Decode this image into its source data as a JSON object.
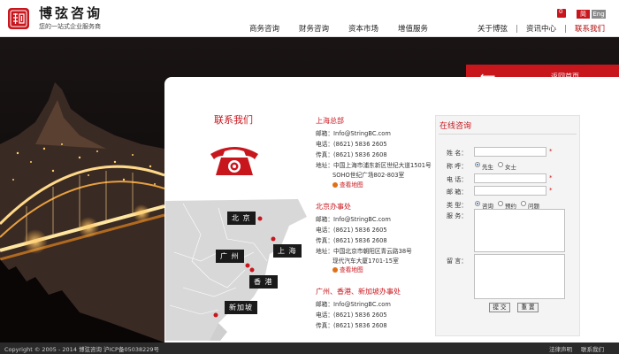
{
  "header": {
    "brand_name": "博弦咨询",
    "brand_tagline": "您的一站式企业服务商",
    "nav": [
      "商务咨询",
      "财务咨询",
      "资本市场",
      "增值服务"
    ],
    "nav_right": [
      "关于博弦",
      "资讯中心",
      "联系我们"
    ],
    "cart_count": "0",
    "lang_cn": "简",
    "lang_en": "Eng"
  },
  "back_home": {
    "label": "返回首页",
    "arrow": "⟵"
  },
  "contact": {
    "title": "联系我们",
    "cities": [
      "北 京",
      "上 海",
      "广 州",
      "香 港",
      "新加坡"
    ]
  },
  "offices": [
    {
      "title": "上海总部",
      "email": "邮箱：Info@StringBC.com",
      "phone": "电话：(8621) 5836 2605",
      "fax": "传真：(8621) 5836 2608",
      "address": "地址：中国上海市浦东新区世纪大道1501号",
      "address2": "SOHO世纪广场802-803室",
      "map_link": "查看地图"
    },
    {
      "title": "北京办事处",
      "email": "邮箱：Info@StringBC.com",
      "phone": "电话：(8621) 5836 2605",
      "fax": "传真：(8621) 5836 2608",
      "address": "地址：中国北京市朝阳区青云路38号",
      "address2": "现代汽车大厦1701-15室",
      "map_link": "查看地图"
    },
    {
      "title": "广州、香港、新加坡办事处",
      "email": "邮箱：Info@StringBC.com",
      "phone": "电话：(8621) 5836 2605",
      "fax": "传真：(8621) 5836 2608"
    }
  ],
  "form": {
    "title": "在线咨询",
    "name_label": "姓 名：",
    "salutation_label": "称 呼：",
    "salutation_options": [
      "先生",
      "女士"
    ],
    "phone_label": "电 话：",
    "email_label": "邮 箱：",
    "type_label": "类 型：",
    "type_options": [
      "咨询",
      "预约",
      "问题"
    ],
    "service_label": "服 务：",
    "message_label": "留 言：",
    "submit_label": "提 交",
    "reset_label": "重 置",
    "required_mark": "*"
  },
  "footer": {
    "copyright": "Copyright © 2005 - 2014 博弦咨询 沪ICP备05038229号",
    "links": [
      "法律声明",
      "联系我们"
    ]
  },
  "colors": {
    "accent": "#c8161d",
    "footer_bg": "#2a2a2a",
    "panel_bg": "#ffffff"
  }
}
